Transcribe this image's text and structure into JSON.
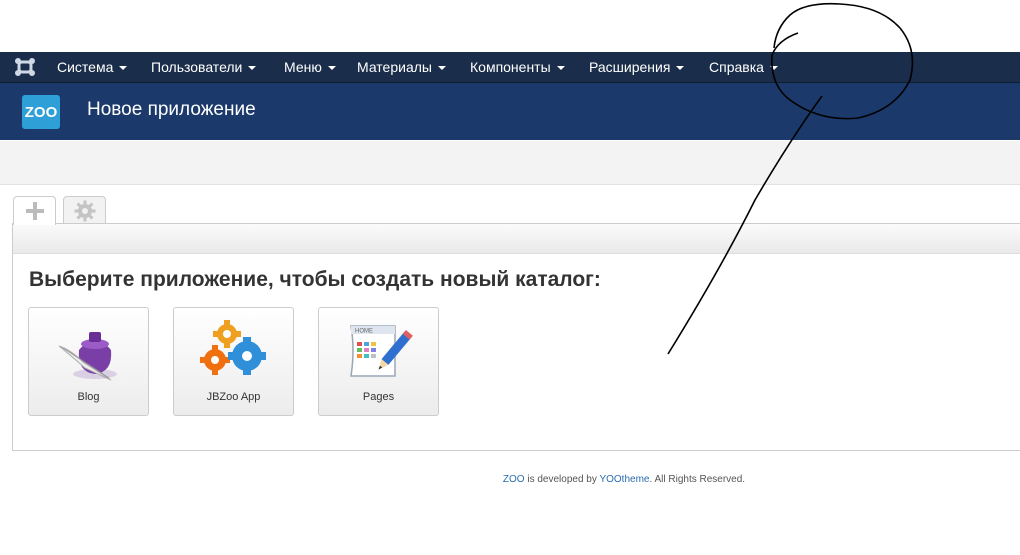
{
  "navbar": {
    "brand_icon": "joomla-logo-icon",
    "menu": [
      {
        "label": "Система"
      },
      {
        "label": "Пользователи"
      },
      {
        "label": "Меню"
      },
      {
        "label": "Материалы"
      },
      {
        "label": "Компоненты"
      },
      {
        "label": "Расширения"
      },
      {
        "label": "Справка"
      }
    ]
  },
  "header": {
    "logo_text": "ZOO",
    "title": "Новое приложение"
  },
  "tabs": [
    {
      "icon": "plus-icon",
      "active": true
    },
    {
      "icon": "gear-icon",
      "active": false
    }
  ],
  "main": {
    "heading": "Выберите приложение, чтобы создать новый каталог:",
    "apps": [
      {
        "label": "Blog",
        "icon": "inkwell-quill-icon"
      },
      {
        "label": "JBZoo App",
        "icon": "gears-icon"
      },
      {
        "label": "Pages",
        "icon": "document-pencil-icon"
      }
    ]
  },
  "footer": {
    "link1": "ZOO",
    "text1": " is developed by ",
    "link2": "YOOtheme",
    "text2": ". All Rights Reserved."
  },
  "colors": {
    "navbar_bg": "#1a2d4a",
    "header_bg": "#1b3a6b",
    "zoo_logo": "#2f9fd8",
    "link": "#2a6db0"
  }
}
